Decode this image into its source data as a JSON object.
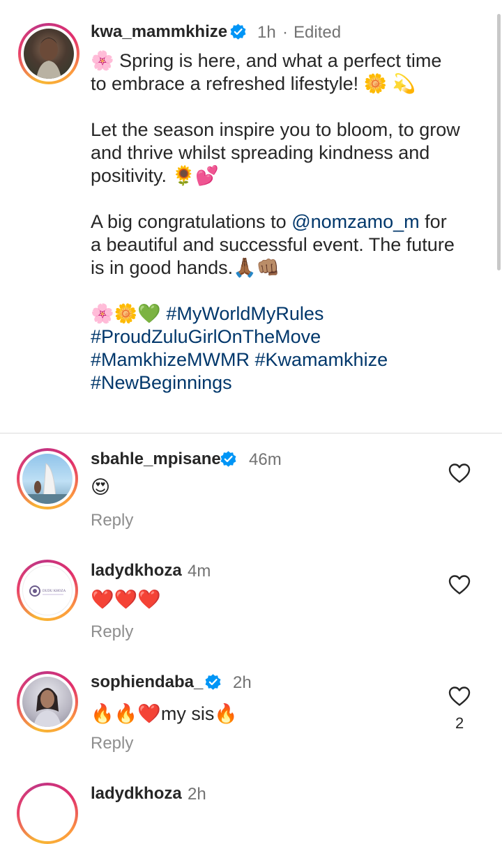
{
  "post": {
    "username": "kwa_mammkhize",
    "time": "1h",
    "separator": "·",
    "edited": "Edited",
    "caption": {
      "line1": "🌸 Spring is here, and what a perfect time to embrace a refreshed lifestyle! 🌼 💫",
      "line2": "Let the season inspire you to bloom, to grow and thrive whilst spreading kindness and positivity. 🌻💕",
      "line3_prefix": "A big congratulations to ",
      "line3_mention": "@nomzamo_m",
      "line3_suffix": " for a beautiful and successful event. The future is in good hands.🙏🏾👊🏽",
      "tags_emoji": "🌸🌼💚 ",
      "tags": "#MyWorldMyRules #ProudZuluGirlOnTheMove #MamkhizeMWMR #Kwamamkhize #NewBeginnings"
    }
  },
  "comments": [
    {
      "username": "sbahle_mpisane",
      "verified": true,
      "time": "46m",
      "text": "😍",
      "reply": "Reply",
      "likes": ""
    },
    {
      "username": "ladydkhoza",
      "verified": false,
      "time": "4m",
      "text": "❤️❤️❤️",
      "reply": "Reply",
      "likes": "",
      "avatar_text": "DUDU KHOZA"
    },
    {
      "username": "sophiendaba_",
      "verified": true,
      "time": "2h",
      "text": "🔥🔥❤️my sis🔥",
      "reply": "Reply",
      "likes": "2"
    },
    {
      "username": "ladydkhoza",
      "verified": false,
      "time": "2h"
    }
  ],
  "colors": {
    "link": "#00376b",
    "verified": "#0095f6",
    "muted": "#737373"
  },
  "icons": {
    "verified": "verified-badge-icon",
    "heart": "heart-outline-icon"
  }
}
